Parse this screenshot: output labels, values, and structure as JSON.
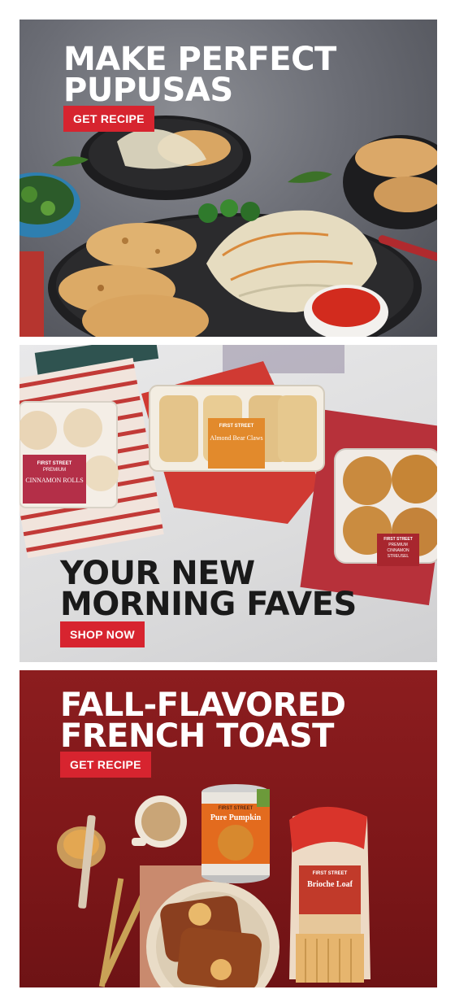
{
  "banners": [
    {
      "headline_line1": "MAKE PERFECT",
      "headline_line2": "PUPUSAS",
      "cta_label": "GET RECIPE"
    },
    {
      "headline_line1": "YOUR NEW",
      "headline_line2": "MORNING FAVES",
      "cta_label": "SHOP NOW",
      "products": {
        "cinnamon_rolls": {
          "brand": "FIRST STREET",
          "tag": "PREMIUM",
          "name": "CINNAMON ROLLS"
        },
        "bear_claws": {
          "brand": "FIRST STREET",
          "name": "Almond Bear Claws"
        },
        "muffins": {
          "brand": "FIRST STREET",
          "tag": "PREMIUM",
          "name": "CINNAMON STREUSEL"
        }
      }
    },
    {
      "headline_line1": "FALL-FLAVORED",
      "headline_line2": "FRENCH TOAST",
      "cta_label": "GET RECIPE",
      "products": {
        "pumpkin": {
          "brand": "FIRST STREET",
          "name": "Pure Pumpkin"
        },
        "brioche": {
          "brand": "FIRST STREET",
          "name": "Brioche Loaf"
        }
      }
    }
  ],
  "colors": {
    "cta_red": "#d7242f",
    "headline_light": "#ffffff",
    "headline_dark": "#1a1a1a",
    "panel3_bg": "#8c1d1f"
  }
}
